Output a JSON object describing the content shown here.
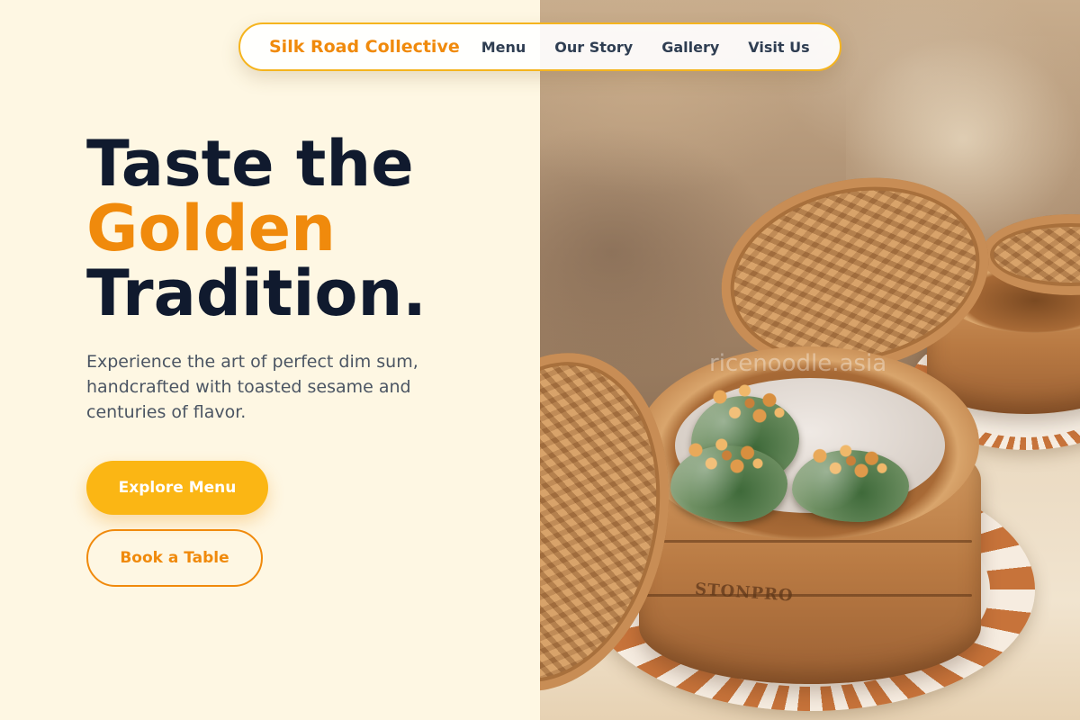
{
  "nav": {
    "brand": "Silk Road Collective",
    "links": [
      "Menu",
      "Our Story",
      "Gallery",
      "Visit Us"
    ]
  },
  "hero": {
    "title_line1": "Taste the",
    "title_line2": "Golden",
    "title_line3": "Tradition.",
    "subtitle": "Experience the art of perfect dim sum, handcrafted with toasted sesame and centuries of flavor.",
    "primary_button": "Explore Menu",
    "secondary_button": "Book a Table"
  },
  "photo": {
    "watermark": "ricenoodle.asia",
    "basket_stamp": "STONPRO"
  },
  "colors": {
    "background": "#fef7e3",
    "accent_orange": "#f08a0c",
    "button_yellow": "#fbb614",
    "heading_navy": "#101a2e",
    "body_gray": "#4b5563"
  }
}
